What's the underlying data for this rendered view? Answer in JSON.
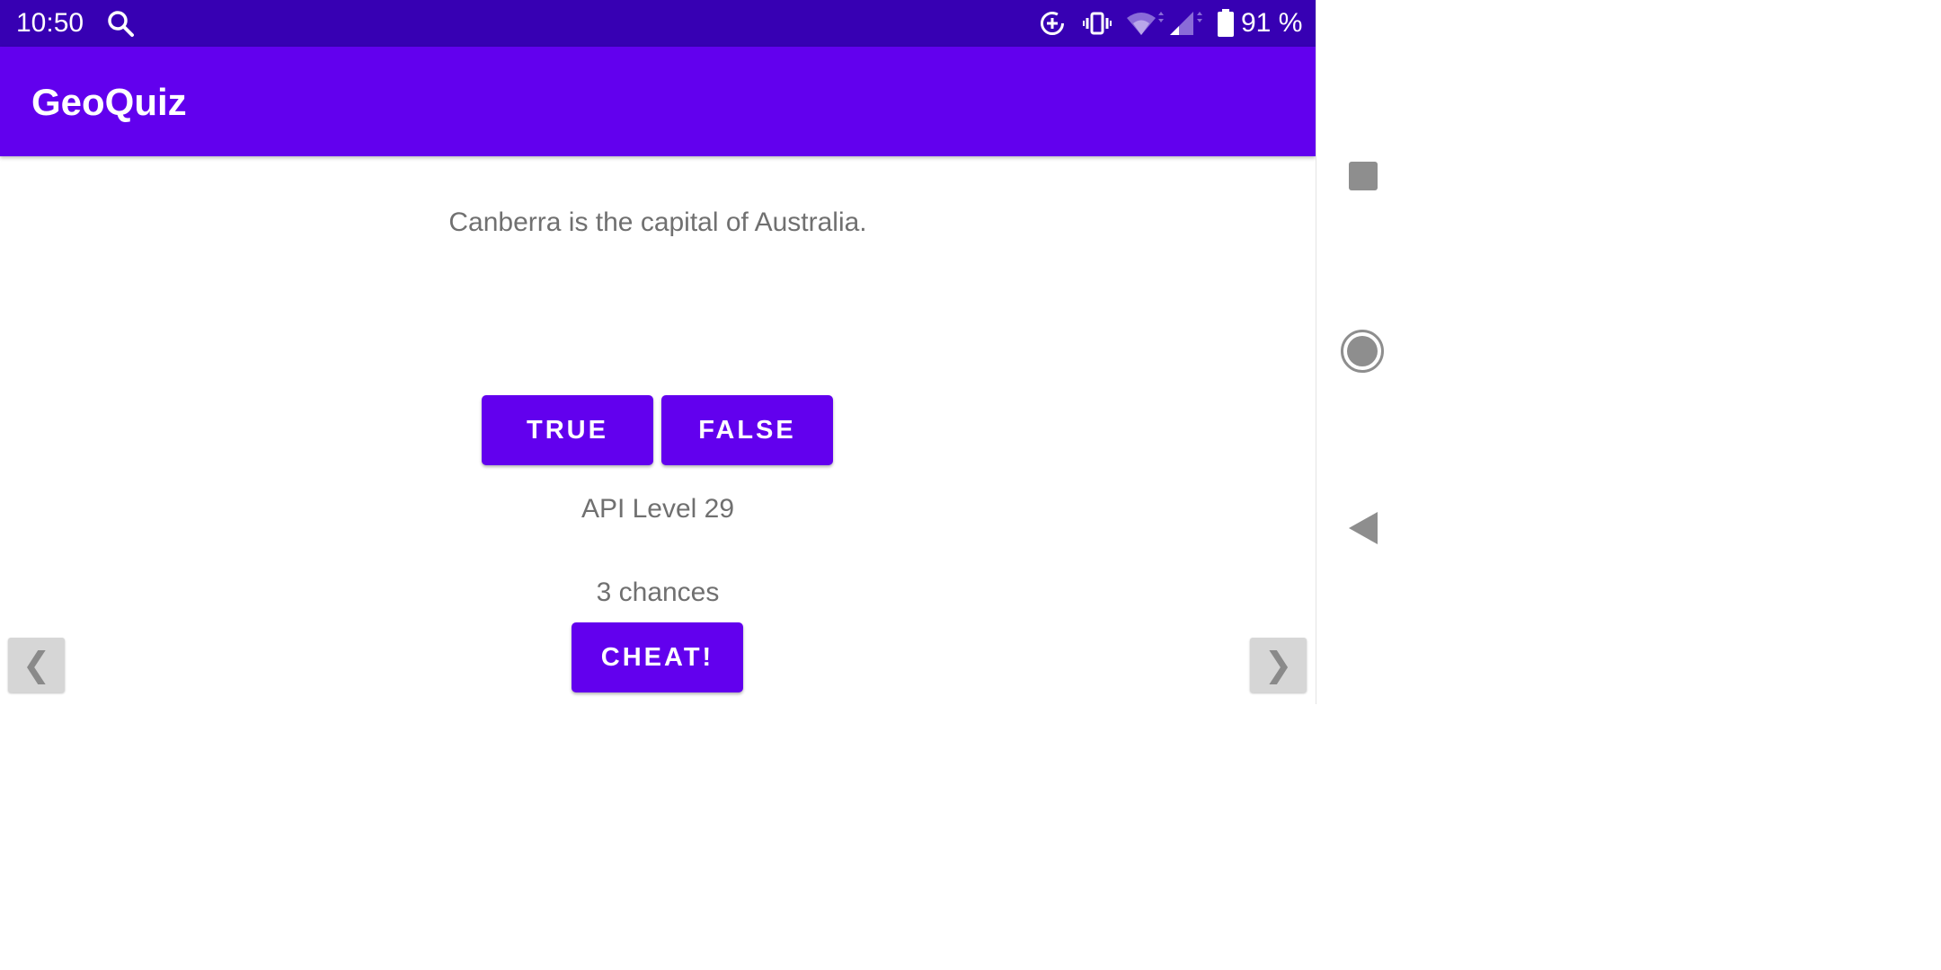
{
  "status_bar": {
    "time": "10:50",
    "battery_text": "91 %",
    "icons": [
      "search-icon",
      "data-saver-icon",
      "vibrate-icon",
      "wifi-icon",
      "cell-signal-icon",
      "battery-icon"
    ]
  },
  "app_bar": {
    "title": "GeoQuiz"
  },
  "main": {
    "question": "Canberra is the capital of Australia.",
    "true_label": "TRUE",
    "false_label": "FALSE",
    "api_level": "API Level 29",
    "chances": "3 chances",
    "cheat_label": "CHEAT!",
    "prev_label": "❮",
    "next_label": "❯"
  },
  "nav_bar": {
    "icons": [
      "recents-icon",
      "home-icon",
      "back-icon"
    ]
  },
  "colors": {
    "status_bar": "#3700b3",
    "primary": "#6200ee",
    "text_secondary": "#707070"
  }
}
